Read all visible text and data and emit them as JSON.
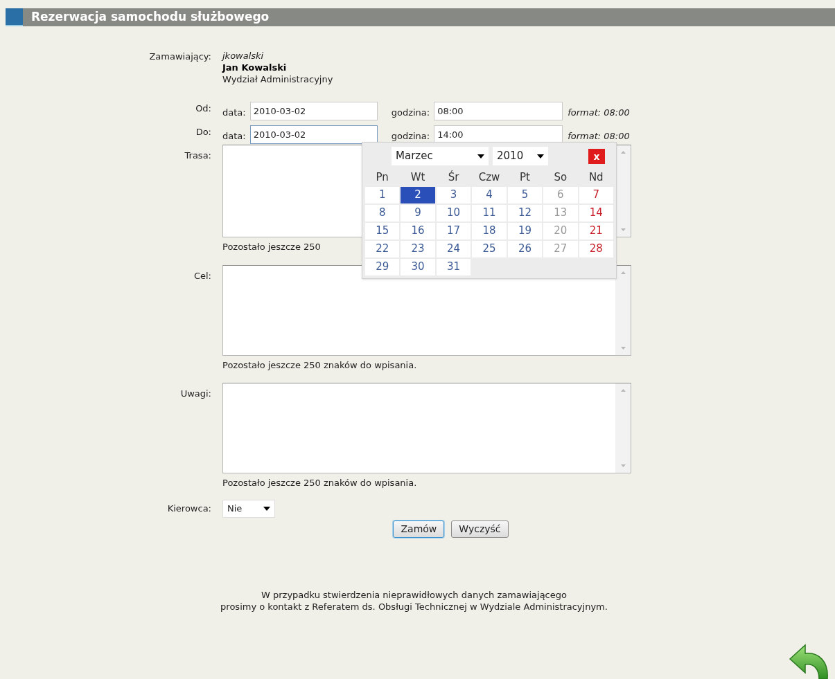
{
  "title": "Rezerwacja samochodu służbowego",
  "orderer": {
    "label": "Zamawiający:",
    "login": "jkowalski",
    "name": "Jan Kowalski",
    "department": "Wydział Administracyjny"
  },
  "time_rows": [
    {
      "label": "Od:",
      "date_label": "data:",
      "date": "2010-03-02",
      "time_label": "godzina:",
      "time": "08:00",
      "hint": "format: 08:00",
      "focused": false
    },
    {
      "label": "Do:",
      "date_label": "data:",
      "date": "2010-03-02",
      "time_label": "godzina:",
      "time": "14:00",
      "hint": "format: 08:00",
      "focused": true
    }
  ],
  "text_areas": [
    {
      "label": "Trasa:",
      "counter": "Pozostało jeszcze 250"
    },
    {
      "label": "Cel:",
      "counter": "Pozostało jeszcze 250 znaków do wpisania."
    },
    {
      "label": "Uwagi:",
      "counter": "Pozostało jeszcze 250 znaków do wpisania."
    }
  ],
  "driver": {
    "label": "Kierowca:",
    "value": "Nie"
  },
  "buttons": [
    {
      "label": "Zamów",
      "focused": true
    },
    {
      "label": "Wyczyść",
      "focused": false
    }
  ],
  "footer": [
    "W przypadku stwierdzenia nieprawidłowych danych zamawiającego",
    "prosimy o kontakt z Referatem ds. Obsługi Technicznej w Wydziale Administracyjnym."
  ],
  "calendar": {
    "month": "Marzec",
    "year": "2010",
    "close": "x",
    "weekdays": [
      "Pn",
      "Wt",
      "Śr",
      "Czw",
      "Pt",
      "So",
      "Nd"
    ],
    "days": [
      {
        "label": "1",
        "kind": "weekday",
        "selected": false
      },
      {
        "label": "2",
        "kind": "weekday",
        "selected": true
      },
      {
        "label": "3",
        "kind": "weekday",
        "selected": false
      },
      {
        "label": "4",
        "kind": "weekday",
        "selected": false
      },
      {
        "label": "5",
        "kind": "weekday",
        "selected": false
      },
      {
        "label": "6",
        "kind": "saturday",
        "selected": false
      },
      {
        "label": "7",
        "kind": "sunday",
        "selected": false
      },
      {
        "label": "8",
        "kind": "weekday",
        "selected": false
      },
      {
        "label": "9",
        "kind": "weekday",
        "selected": false
      },
      {
        "label": "10",
        "kind": "weekday",
        "selected": false
      },
      {
        "label": "11",
        "kind": "weekday",
        "selected": false
      },
      {
        "label": "12",
        "kind": "weekday",
        "selected": false
      },
      {
        "label": "13",
        "kind": "saturday",
        "selected": false
      },
      {
        "label": "14",
        "kind": "sunday",
        "selected": false
      },
      {
        "label": "15",
        "kind": "weekday",
        "selected": false
      },
      {
        "label": "16",
        "kind": "weekday",
        "selected": false
      },
      {
        "label": "17",
        "kind": "weekday",
        "selected": false
      },
      {
        "label": "18",
        "kind": "weekday",
        "selected": false
      },
      {
        "label": "19",
        "kind": "weekday",
        "selected": false
      },
      {
        "label": "20",
        "kind": "saturday",
        "selected": false
      },
      {
        "label": "21",
        "kind": "sunday",
        "selected": false
      },
      {
        "label": "22",
        "kind": "weekday",
        "selected": false
      },
      {
        "label": "23",
        "kind": "weekday",
        "selected": false
      },
      {
        "label": "24",
        "kind": "weekday",
        "selected": false
      },
      {
        "label": "25",
        "kind": "weekday",
        "selected": false
      },
      {
        "label": "26",
        "kind": "weekday",
        "selected": false
      },
      {
        "label": "27",
        "kind": "saturday",
        "selected": false
      },
      {
        "label": "28",
        "kind": "sunday",
        "selected": false
      },
      {
        "label": "29",
        "kind": "weekday",
        "selected": false
      },
      {
        "label": "30",
        "kind": "weekday",
        "selected": false
      },
      {
        "label": "31",
        "kind": "weekday",
        "selected": false
      }
    ]
  }
}
